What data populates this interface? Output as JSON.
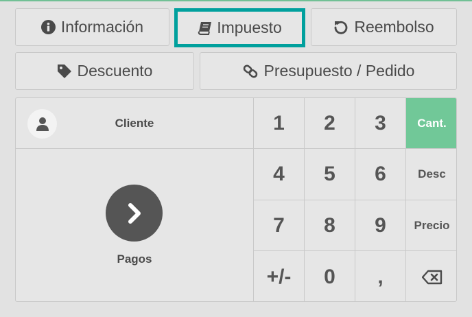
{
  "actions": {
    "info_label": "Información",
    "tax_label": "Impuesto",
    "refund_label": "Reembolso",
    "discount_label": "Descuento",
    "quotation_label": "Presupuesto / Pedido"
  },
  "numpad": {
    "customer_label": "Cliente",
    "payment_label": "Pagos",
    "keys": {
      "k1": "1",
      "k2": "2",
      "k3": "3",
      "k4": "4",
      "k5": "5",
      "k6": "6",
      "k7": "7",
      "k8": "8",
      "k9": "9",
      "plusminus": "+/-",
      "k0": "0",
      "decimal": ","
    },
    "modes": {
      "qty": "Cant.",
      "disc": "Desc",
      "price": "Precio"
    },
    "selected_mode": "Cant."
  },
  "icons": {
    "info": "info-circle-icon",
    "tax": "book-icon",
    "refund": "undo-icon",
    "discount": "tag-icon",
    "quotation": "link-icon",
    "customer": "user-icon",
    "payment": "chevron-right-icon",
    "backspace": "backspace-icon"
  },
  "colors": {
    "active_border": "#00a09d",
    "selected_mode": "#71c898",
    "payment_circle": "#555555"
  }
}
